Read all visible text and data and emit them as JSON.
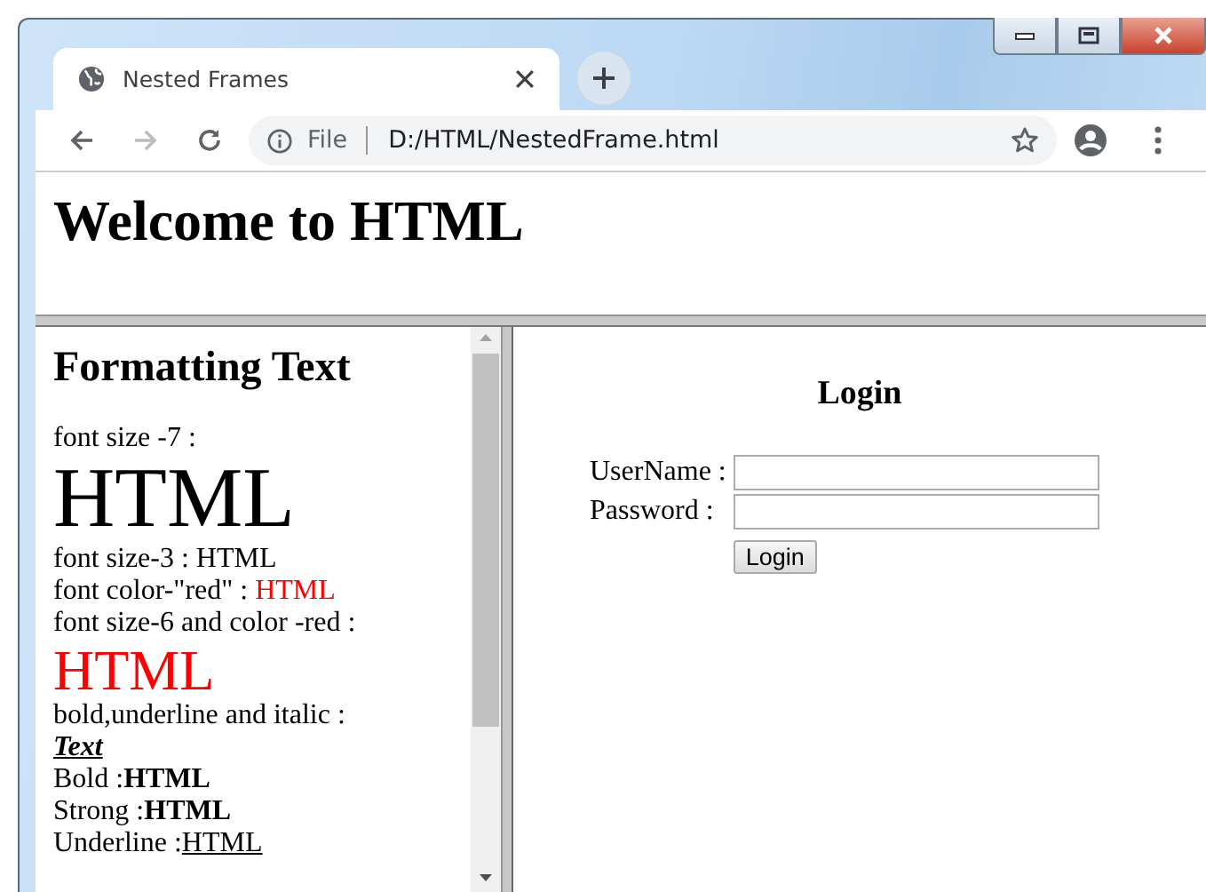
{
  "tab": {
    "title": "Nested Frames",
    "selected": true
  },
  "nav": [
    {
      "kind": "back",
      "disabled": false
    },
    {
      "kind": "forward",
      "disabled": true
    },
    {
      "kind": "reload",
      "disabled": false
    }
  ],
  "address": {
    "scheme": "File",
    "url": "D:/HTML/NestedFrame.html"
  },
  "header_frame": {
    "heading": "Welcome to HTML"
  },
  "format_frame": {
    "heading": "Formatting Text",
    "items": [
      {
        "kind": "text",
        "text": "font size -7 :"
      },
      {
        "kind": "huge",
        "text": "HTML"
      },
      {
        "kind": "text",
        "text": "font size-3 : HTML"
      },
      {
        "kind": "red-pair",
        "label": "font color-\"red\" : ",
        "value": "HTML"
      },
      {
        "kind": "text",
        "text": "font size-6 and color -red :"
      },
      {
        "kind": "large-red",
        "text": "HTML"
      },
      {
        "kind": "text",
        "text": "bold,underline and italic :"
      },
      {
        "kind": "emphasis",
        "text": "Text"
      },
      {
        "kind": "bold-pair",
        "label": "Bold :",
        "value": "HTML"
      },
      {
        "kind": "bold-pair",
        "label": "Strong :",
        "value": "HTML"
      },
      {
        "kind": "underline-pair",
        "label": "Underline :",
        "value": "HTML"
      }
    ]
  },
  "login_frame": {
    "heading": "Login",
    "fields": [
      {
        "label": "UserName :"
      },
      {
        "label": "Password :"
      }
    ],
    "button": "Login"
  }
}
